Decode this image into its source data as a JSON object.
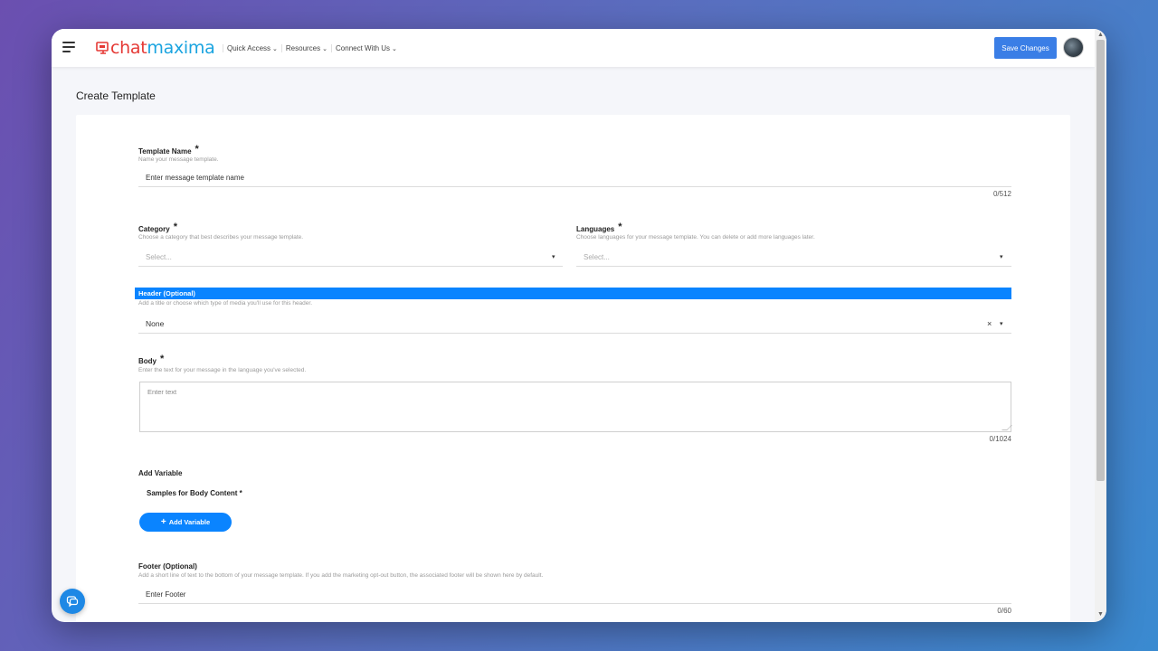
{
  "app": {
    "logo_part1": "chat",
    "logo_part2": "maxima",
    "nav": [
      {
        "label": "Quick Access"
      },
      {
        "label": "Resources"
      },
      {
        "label": "Connect With Us"
      }
    ],
    "save_button": "Save Changes",
    "brand_colors": {
      "red": "#e53935",
      "blue": "#1aa4e0",
      "primary": "#0a84ff"
    }
  },
  "page": {
    "title": "Create Template"
  },
  "form": {
    "template_name": {
      "label": "Template Name",
      "required": "*",
      "hint": "Name your message template.",
      "placeholder": "Enter message template name",
      "counter": "0/512"
    },
    "category": {
      "label": "Category",
      "required": "*",
      "hint": "Choose a category that best describes your message template.",
      "placeholder": "Select..."
    },
    "languages": {
      "label": "Languages",
      "required": "*",
      "hint": "Choose languages for your message template. You can delete or add more languages later.",
      "placeholder": "Select..."
    },
    "header": {
      "label": "Header (Optional)",
      "hint": "Add a title or choose which type of media you'll use for this header.",
      "value": "None",
      "clear": "×"
    },
    "body": {
      "label": "Body",
      "required": "*",
      "hint": "Enter the text for your message in the language you've selected.",
      "placeholder": "Enter text",
      "counter": "0/1024"
    },
    "add_variable": {
      "label": "Add Variable",
      "samples_label": "Samples for Body Content *",
      "button": "Add Variable",
      "button_icon": "+"
    },
    "footer": {
      "label": "Footer (Optional)",
      "hint": "Add a short line of text to the bottom of your message template. If you add the marketing opt-out button, the associated footer will be shown here by default.",
      "placeholder": "Enter Footer",
      "counter": "0/60"
    }
  },
  "icons": {
    "menu": "hamburger-icon",
    "chat_fab": "chat-bubble-icon",
    "caret": "chevron-down-icon"
  }
}
